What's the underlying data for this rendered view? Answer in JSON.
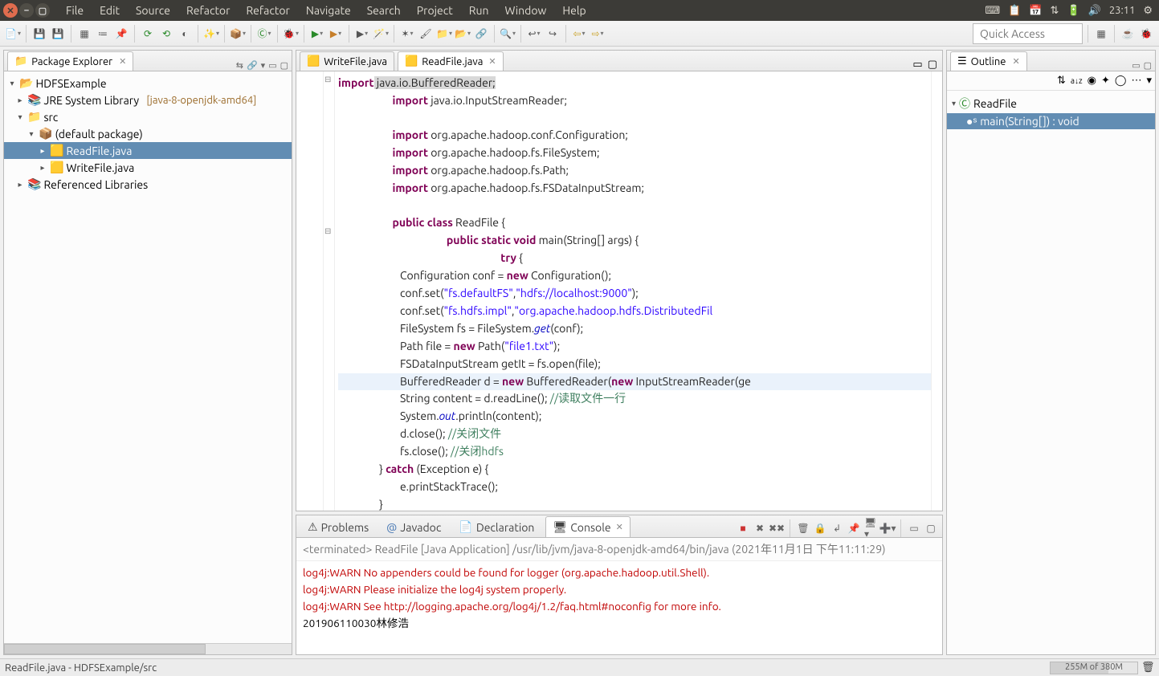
{
  "os_menu": [
    "File",
    "Edit",
    "Source",
    "Refactor",
    "Refactor",
    "Navigate",
    "Search",
    "Project",
    "Run",
    "Window",
    "Help"
  ],
  "clock": "23:11",
  "quick_access": "Quick Access",
  "package_explorer": {
    "title": "Package Explorer",
    "project": "HDFSExample",
    "jre": "JRE System Library",
    "jre_detail": "[java-8-openjdk-amd64]",
    "src": "src",
    "pkg": "(default package)",
    "file1": "ReadFile.java",
    "file2": "WriteFile.java",
    "reflib": "Referenced Libraries"
  },
  "editor_tabs": {
    "t1": "WriteFile.java",
    "t2": "ReadFile.java"
  },
  "code": {
    "l01a": "import",
    "l01b": " java.io.BufferedReader;",
    "l02a": "import",
    "l02b": " java.io.InputStreamReader;",
    "l04a": "import",
    "l04b": " org.apache.hadoop.conf.Configuration;",
    "l05a": "import",
    "l05b": " org.apache.hadoop.fs.FileSystem;",
    "l06a": "import",
    "l06b": " org.apache.hadoop.fs.Path;",
    "l07a": "import",
    "l07b": " org.apache.hadoop.fs.FSDataInputStream;",
    "l09a": "public class",
    "l09b": " ReadFile {",
    "l10a": "public static void",
    "l10b": " main(String[] args) {",
    "l11a": "try",
    "l11b": " {",
    "l12": "                        Configuration conf = ",
    "l12n": "new",
    "l12c": " Configuration();",
    "l13a": "                        conf.set(",
    "l13s1": "\"fs.defaultFS\"",
    "l13m": ",",
    "l13s2": "\"hdfs://localhost:9000\"",
    "l13e": ");",
    "l14a": "                        conf.set(",
    "l14s1": "\"fs.hdfs.impl\"",
    "l14m": ",",
    "l14s2": "\"org.apache.hadoop.hdfs.DistributedFil",
    "l15": "                        FileSystem fs = FileSystem.",
    "l15g": "get",
    "l15e": "(conf);",
    "l16a": "                        Path file = ",
    "l16n": "new",
    "l16b": " Path(",
    "l16s": "\"file1.txt\"",
    "l16e": ");",
    "l17": "                        FSDataInputStream getIt = fs.open(file);",
    "l18a": "                        BufferedReader d = ",
    "l18n": "new",
    "l18b": " BufferedReader(",
    "l18n2": "new",
    "l18c": " InputStreamReader(ge",
    "l19a": "                        String content = d.readLine(); ",
    "l19c": "//读取文件一行",
    "l20a": "                        System.",
    "l20o": "out",
    "l20b": ".println(content);",
    "l21a": "                        d.close(); ",
    "l21c": "//关闭文件",
    "l22a": "                        fs.close(); ",
    "l22c": "//关闭hdfs",
    "l23": "                } ",
    "l23k": "catch",
    "l23b": " (Exception e) {",
    "l24": "                        e.printStackTrace();",
    "l25": "                }"
  },
  "outline": {
    "title": "Outline",
    "class": "ReadFile",
    "method": "main(String[]) : void"
  },
  "bottom": {
    "tab_problems": "Problems",
    "tab_javadoc": "Javadoc",
    "tab_decl": "Declaration",
    "tab_console": "Console",
    "header": "<terminated> ReadFile [Java Application] /usr/lib/jvm/java-8-openjdk-amd64/bin/java (2021年11月1日 下午11:11:29)",
    "l1": "log4j:WARN No appenders could be found for logger (org.apache.hadoop.util.Shell).",
    "l2": "log4j:WARN Please initialize the log4j system properly.",
    "l3": "log4j:WARN See http://logging.apache.org/log4j/1.2/faq.html#noconfig for more info.",
    "l4": "201906110030林修浩"
  },
  "status": {
    "path": "ReadFile.java - HDFSExample/src",
    "heap": "255M of 380M"
  }
}
